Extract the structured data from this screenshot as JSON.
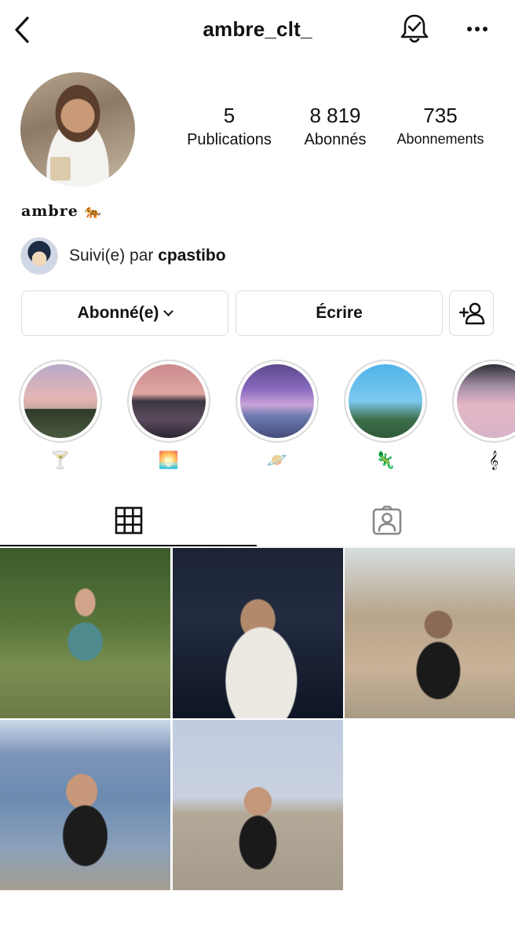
{
  "header": {
    "username": "ambre_clt_"
  },
  "profile": {
    "display_name": "ambre",
    "display_emoji": "🐅",
    "stats": [
      {
        "value": "5",
        "label": "Publications"
      },
      {
        "value": "8 819",
        "label": "Abonnés"
      },
      {
        "value": "735",
        "label": "Abonnements"
      }
    ],
    "followed_by_prefix": "Suivi(e) par",
    "followed_by_user": "cpastibo"
  },
  "actions": {
    "follow_label": "Abonné(e)",
    "write_label": "Écrire"
  },
  "highlights": [
    {
      "label": "🍸"
    },
    {
      "label": "🌅"
    },
    {
      "label": "🪐"
    },
    {
      "label": "🦎"
    },
    {
      "label": "𝄞"
    }
  ],
  "tabs": {
    "active": "grid"
  },
  "posts_count_visible": 5
}
